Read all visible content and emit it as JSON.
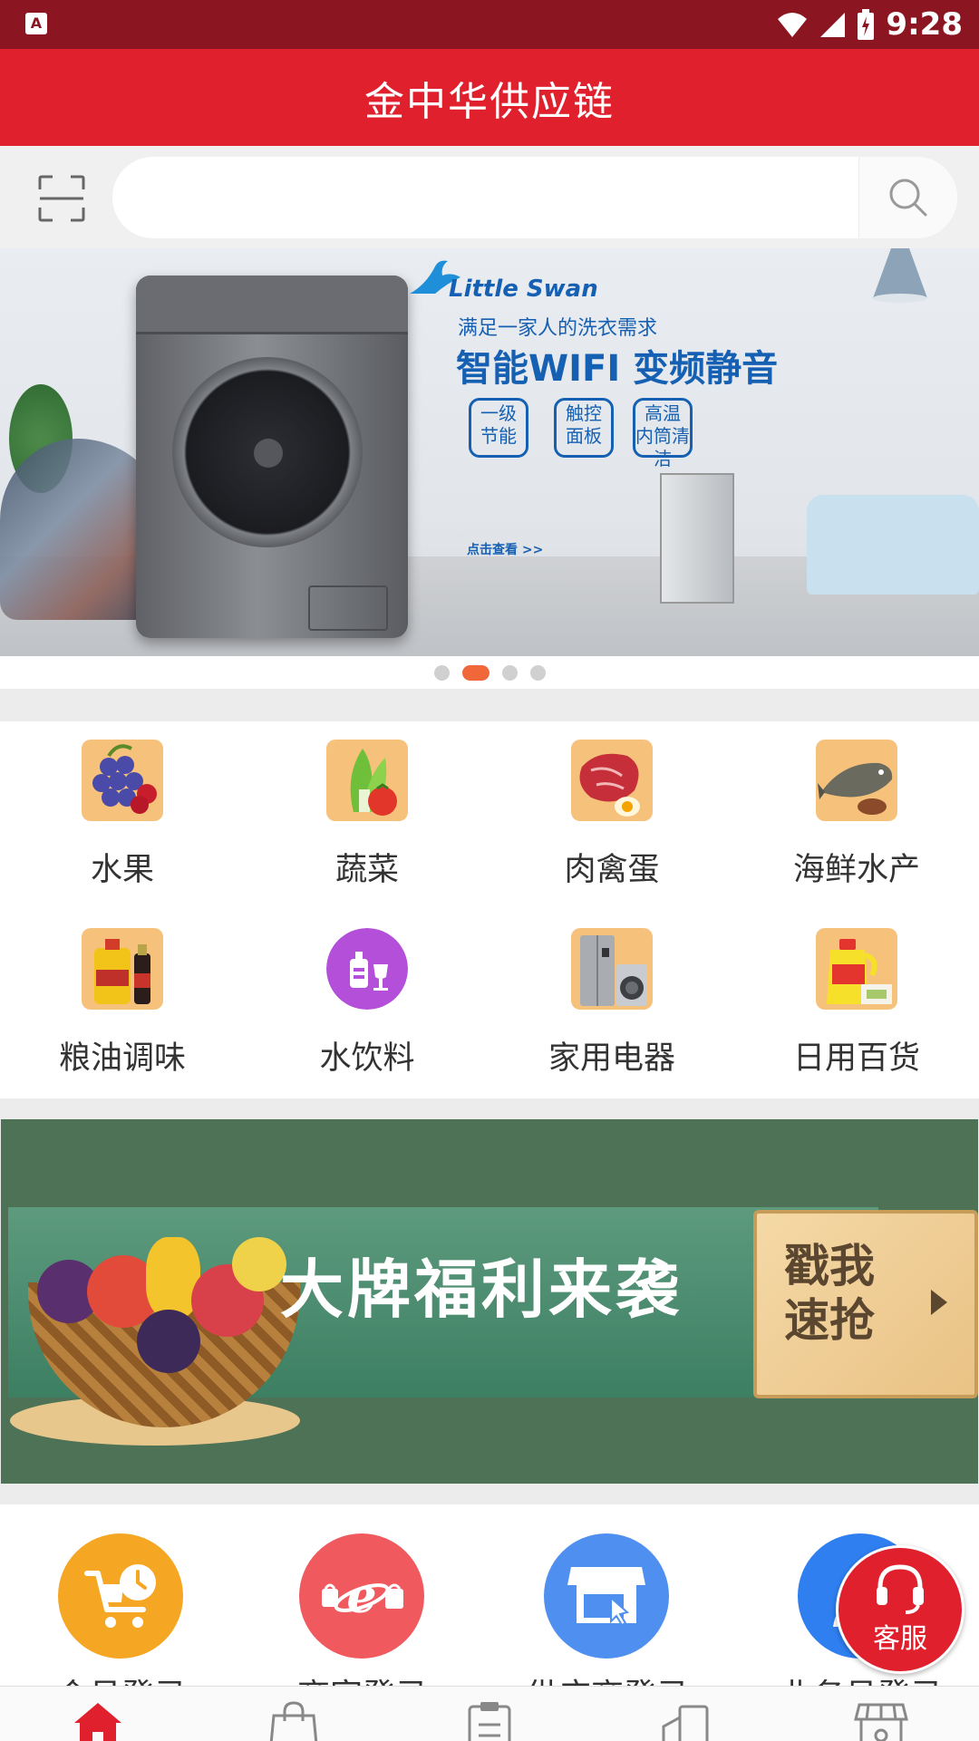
{
  "status_bar": {
    "left_icon": "A",
    "time": "9:28",
    "icons": [
      "wifi-icon",
      "signal-icon",
      "battery-icon"
    ]
  },
  "header": {
    "title": "金中华供应链"
  },
  "search": {
    "value": "",
    "placeholder": ""
  },
  "banner": {
    "brand": "Little Swan",
    "subtitle": "满足一家人的洗衣需求",
    "headline": "智能WIFI 变频静音",
    "features": [
      "一级节能",
      "触控面板",
      "高温内筒清洁"
    ],
    "link": "点击查看 >>",
    "slide_count": 4,
    "active_slide": 2
  },
  "categories": [
    {
      "label": "水果",
      "icon": "grapes-icon"
    },
    {
      "label": "蔬菜",
      "icon": "vegetable-icon"
    },
    {
      "label": "肉禽蛋",
      "icon": "meat-icon"
    },
    {
      "label": "海鲜水产",
      "icon": "fish-icon"
    },
    {
      "label": "粮油调味",
      "icon": "oil-icon"
    },
    {
      "label": "水饮料",
      "icon": "drink-icon"
    },
    {
      "label": "家用电器",
      "icon": "appliance-icon"
    },
    {
      "label": "日用百货",
      "icon": "detergent-icon"
    }
  ],
  "promo": {
    "headline": "大牌福利来袭",
    "ticket_line1": "戳我",
    "ticket_line2": "速抢"
  },
  "logins": [
    {
      "label": "会员登录",
      "icon": "cart-clock-icon",
      "color": "#f5a623"
    },
    {
      "label": "商家登录",
      "icon": "ie-bag-icon",
      "color": "#f05a5f"
    },
    {
      "label": "供应商登录",
      "icon": "store-icon",
      "color": "#4f8ff0"
    },
    {
      "label": "业务员登录",
      "icon": "user-icon",
      "color": "#2f7ff0"
    }
  ],
  "customer_service": {
    "label": "客服"
  },
  "bottom_nav": [
    {
      "icon": "home-icon",
      "active": true
    },
    {
      "icon": "bag-icon",
      "active": false
    },
    {
      "icon": "clipboard-icon",
      "active": false
    },
    {
      "icon": "truck-icon",
      "active": false
    },
    {
      "icon": "shop-icon",
      "active": false
    }
  ],
  "colors": {
    "status_bar": "#8b1520",
    "primary": "#e0202d",
    "active_dot": "#f0683a"
  }
}
